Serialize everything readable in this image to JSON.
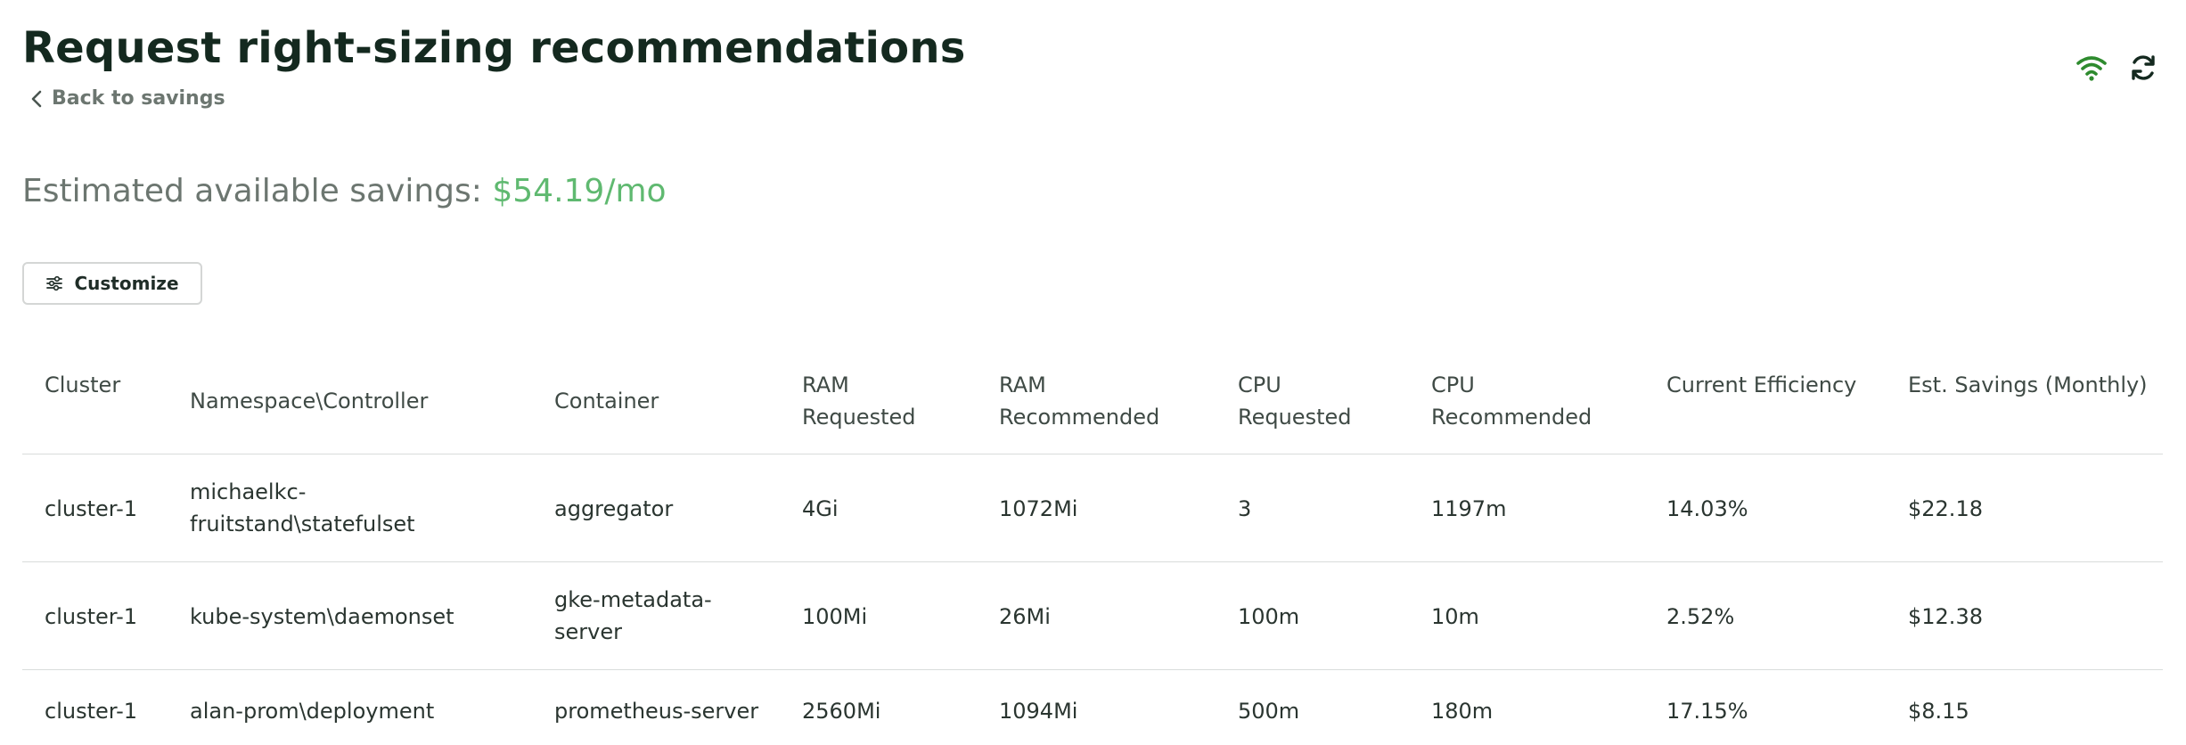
{
  "page": {
    "title": "Request right-sizing recommendations",
    "back_label": "Back to savings"
  },
  "icons": {
    "wifi": "wifi-icon",
    "refresh": "refresh-icon",
    "back": "chevron-left-icon",
    "customize": "sliders-icon"
  },
  "colors": {
    "title": "#14291f",
    "savings_amount": "#5fb970",
    "wifi": "#2e8b2e"
  },
  "savings": {
    "label": "Estimated available savings:",
    "amount": "$54.19/mo"
  },
  "toolbar": {
    "customize_label": "Customize"
  },
  "table": {
    "headers": {
      "cluster": "Cluster",
      "namespace": "Namespace\\Controller",
      "container": "Container",
      "ram_requested_1": "RAM",
      "ram_requested_2": "Requested",
      "ram_recommended_1": "RAM",
      "ram_recommended_2": "Recommended",
      "cpu_requested_1": "CPU",
      "cpu_requested_2": "Requested",
      "cpu_recommended_1": "CPU",
      "cpu_recommended_2": "Recommended",
      "efficiency": "Current Efficiency",
      "savings": "Est. Savings (Monthly)"
    },
    "rows": [
      {
        "cluster": "cluster-1",
        "namespace_1": "michaelkc-",
        "namespace_2": "fruitstand\\statefulset",
        "container": "aggregator",
        "ram_requested": "4Gi",
        "ram_recommended": "1072Mi",
        "cpu_requested": "3",
        "cpu_recommended": "1197m",
        "efficiency": "14.03%",
        "savings": "$22.18"
      },
      {
        "cluster": "cluster-1",
        "namespace": "kube-system\\daemonset",
        "container_1": "gke-metadata-",
        "container_2": "server",
        "ram_requested": "100Mi",
        "ram_recommended": "26Mi",
        "cpu_requested": "100m",
        "cpu_recommended": "10m",
        "efficiency": "2.52%",
        "savings": "$12.38"
      },
      {
        "cluster": "cluster-1",
        "namespace": "alan-prom\\deployment",
        "container": "prometheus-server",
        "ram_requested": "2560Mi",
        "ram_recommended": "1094Mi",
        "cpu_requested": "500m",
        "cpu_recommended": "180m",
        "efficiency": "17.15%",
        "savings": "$8.15"
      }
    ]
  }
}
